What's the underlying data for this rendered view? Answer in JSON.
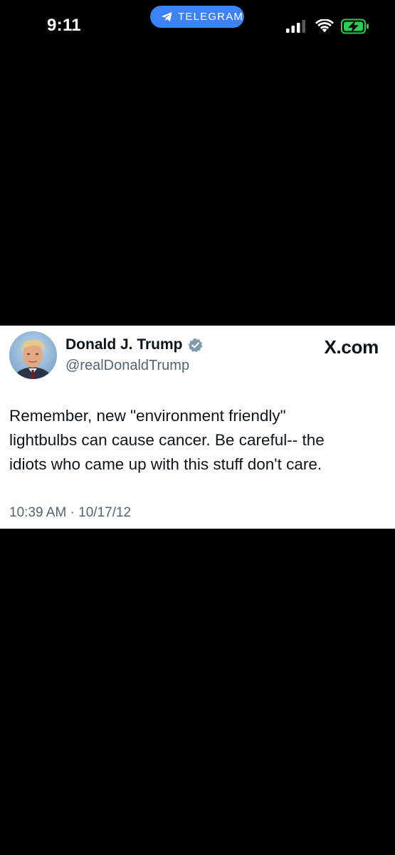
{
  "status_bar": {
    "time": "9:11",
    "pill_label": "TELEGRAM",
    "icons": [
      "telegram-plane-icon",
      "cellular-signal-icon",
      "wifi-icon",
      "battery-charging-icon"
    ],
    "colors": {
      "pill": "#3d82f6",
      "battery_fill": "#34c759"
    }
  },
  "tweet": {
    "author_name": "Donald J. Trump",
    "author_handle": "@realDonaldTrump",
    "brand": "X.com",
    "text_lines": [
      "Remember, new \"environment friendly\"",
      "lightbulbs can cause cancer. Be careful-- the",
      "idiots who came up with this stuff don't care."
    ],
    "timestamp": "10:39 AM · 10/17/12",
    "icons": [
      "avatar",
      "verified-badge-icon"
    ],
    "colors": {
      "text": "#0f1419",
      "secondary": "#536471",
      "badge": "#829aab"
    }
  }
}
